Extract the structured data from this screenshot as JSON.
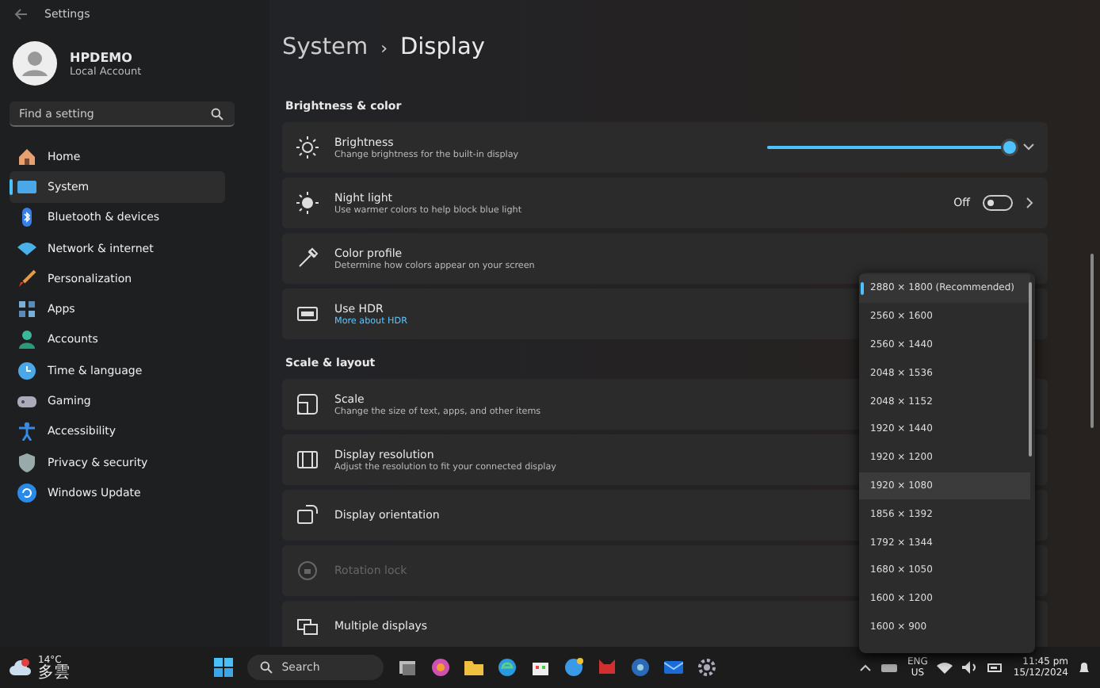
{
  "window": {
    "title": "Settings"
  },
  "account": {
    "name": "HPDEMO",
    "type": "Local Account"
  },
  "search": {
    "placeholder": "Find a setting"
  },
  "sidebar": {
    "items": [
      {
        "label": "Home",
        "selected": false
      },
      {
        "label": "System",
        "selected": true
      },
      {
        "label": "Bluetooth & devices",
        "selected": false
      },
      {
        "label": "Network & internet",
        "selected": false
      },
      {
        "label": "Personalization",
        "selected": false
      },
      {
        "label": "Apps",
        "selected": false
      },
      {
        "label": "Accounts",
        "selected": false
      },
      {
        "label": "Time & language",
        "selected": false
      },
      {
        "label": "Gaming",
        "selected": false
      },
      {
        "label": "Accessibility",
        "selected": false
      },
      {
        "label": "Privacy & security",
        "selected": false
      },
      {
        "label": "Windows Update",
        "selected": false
      }
    ]
  },
  "breadcrumb": {
    "parent": "System",
    "separator": "›",
    "current": "Display"
  },
  "sections": [
    {
      "heading": "Brightness & color",
      "rows": [
        {
          "kind": "slider",
          "title": "Brightness",
          "subtitle": "Change brightness for the built-in display",
          "level": 1.0
        },
        {
          "kind": "toggle",
          "title": "Night light",
          "subtitle": "Use warmer colors to help block blue light",
          "state_label": "Off",
          "on": false
        },
        {
          "kind": "plain",
          "title": "Color profile",
          "subtitle": "Determine how colors appear on your screen"
        },
        {
          "kind": "link",
          "title": "Use HDR",
          "link": "More about HDR"
        }
      ]
    },
    {
      "heading": "Scale & layout",
      "rows": [
        {
          "kind": "plain",
          "title": "Scale",
          "subtitle": "Change the size of text, apps, and other items"
        },
        {
          "kind": "plain",
          "title": "Display resolution",
          "subtitle": "Adjust the resolution to fit your connected display"
        },
        {
          "kind": "plain",
          "title": "Display orientation"
        },
        {
          "kind": "plain",
          "title": "Rotation lock",
          "disabled": true
        },
        {
          "kind": "plain",
          "title": "Multiple displays"
        }
      ]
    }
  ],
  "resolution_menu": {
    "options": [
      {
        "label": "2880 × 1800 (Recommended)",
        "selected": true,
        "hovered": false
      },
      {
        "label": "2560 × 1600",
        "selected": false,
        "hovered": false
      },
      {
        "label": "2560 × 1440",
        "selected": false,
        "hovered": false
      },
      {
        "label": "2048 × 1536",
        "selected": false,
        "hovered": false
      },
      {
        "label": "2048 × 1152",
        "selected": false,
        "hovered": false
      },
      {
        "label": "1920 × 1440",
        "selected": false,
        "hovered": false
      },
      {
        "label": "1920 × 1200",
        "selected": false,
        "hovered": false
      },
      {
        "label": "1920 × 1080",
        "selected": false,
        "hovered": true
      },
      {
        "label": "1856 × 1392",
        "selected": false,
        "hovered": false
      },
      {
        "label": "1792 × 1344",
        "selected": false,
        "hovered": false
      },
      {
        "label": "1680 × 1050",
        "selected": false,
        "hovered": false
      },
      {
        "label": "1600 × 1200",
        "selected": false,
        "hovered": false
      },
      {
        "label": "1600 × 900",
        "selected": false,
        "hovered": false
      }
    ]
  },
  "taskbar": {
    "weather": {
      "temperature": "14°C",
      "condition": "多雲"
    },
    "search": "Search",
    "language": "ENG",
    "region": "US",
    "time": "11:45 pm",
    "date": "15/12/2024"
  }
}
